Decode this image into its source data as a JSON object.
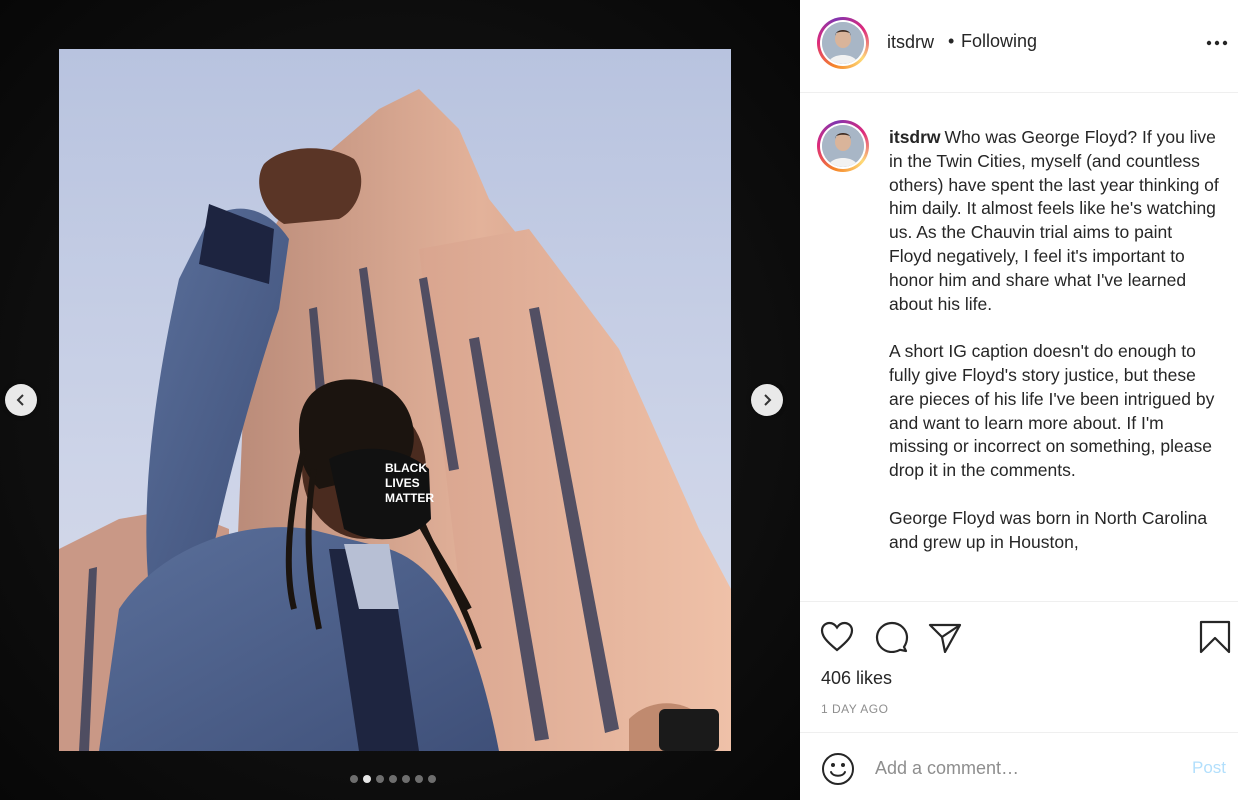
{
  "media": {
    "image_description_icon": "protest-photo",
    "photo_mask_text": [
      "BLACK",
      "LIVES",
      "MATTER"
    ],
    "carousel": {
      "total_slides": 7,
      "active_index": 1
    },
    "prev_icon": "chevron-left-icon",
    "next_icon": "chevron-right-icon"
  },
  "post": {
    "username": "itsdrw",
    "separator": "•",
    "follow_status": "Following",
    "more_icon": "more-options-icon",
    "caption": {
      "username": "itsdrw",
      "paragraphs": [
        "Who was George Floyd? If you live in the Twin Cities, myself (and countless others) have spent the last year thinking of him daily. It almost feels like he's watching us. As the Chauvin trial aims to paint Floyd negatively, I feel it's important to honor him and share what I've learned about his life.",
        "A short IG caption doesn't do enough to fully give Floyd's story justice, but these are pieces of his life I've been intrigued by and want to learn more about. If I'm missing or incorrect on something, please drop it in the comments.",
        "George Floyd was born in North Carolina and grew up in Houston,"
      ]
    },
    "likes": "406 likes",
    "timestamp": "1 DAY AGO",
    "comment": {
      "placeholder": "Add a comment…",
      "post_label": "Post"
    }
  },
  "colors": {
    "post_button_disabled": "#b2dffc",
    "muted_text": "#8e8e8e",
    "text": "#262626"
  }
}
